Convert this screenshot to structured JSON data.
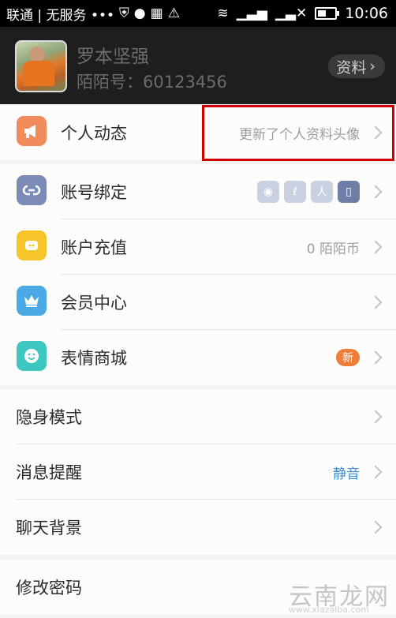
{
  "status_bar": {
    "carrier": "联通 | 无服务 •••",
    "time": "10:06",
    "icons": [
      "shield-icon",
      "wechat-icon",
      "grid-icon",
      "warning-icon",
      "wifi-icon",
      "signal-icon",
      "no-signal-icon",
      "battery-icon"
    ]
  },
  "profile": {
    "name": "罗本坚强",
    "id_text": "陌陌号：60123456",
    "button_label": "资料"
  },
  "section1": [
    {
      "label": "个人动态",
      "value": "更新了个人资料头像",
      "icon": "megaphone-icon",
      "color": "#f28b5b"
    }
  ],
  "section2": [
    {
      "label": "账号绑定",
      "icon": "link-icon",
      "color": "#7b8bb5",
      "bind_icons": [
        "weibo-icon",
        "qq-weibo-icon",
        "renren-icon",
        "phone-icon"
      ]
    },
    {
      "label": "账户充值",
      "value": "0 陌陌币",
      "icon": "coin-icon",
      "color": "#f5c52a"
    },
    {
      "label": "会员中心",
      "icon": "crown-icon",
      "color": "#4ba9e6"
    },
    {
      "label": "表情商城",
      "icon": "smile-icon",
      "color": "#3ec6c0",
      "badge": "新"
    }
  ],
  "section3": [
    {
      "label": "隐身模式"
    },
    {
      "label": "消息提醒",
      "value": "静音"
    },
    {
      "label": "聊天背景"
    }
  ],
  "section4": [
    {
      "label": "修改密码"
    }
  ],
  "watermark": {
    "main": "云南龙网",
    "sub": "www.xiazaiba.com"
  },
  "colors": {
    "accent": "#3a8fd8",
    "highlight": "#d10000",
    "badge": "#ef7d3a"
  }
}
